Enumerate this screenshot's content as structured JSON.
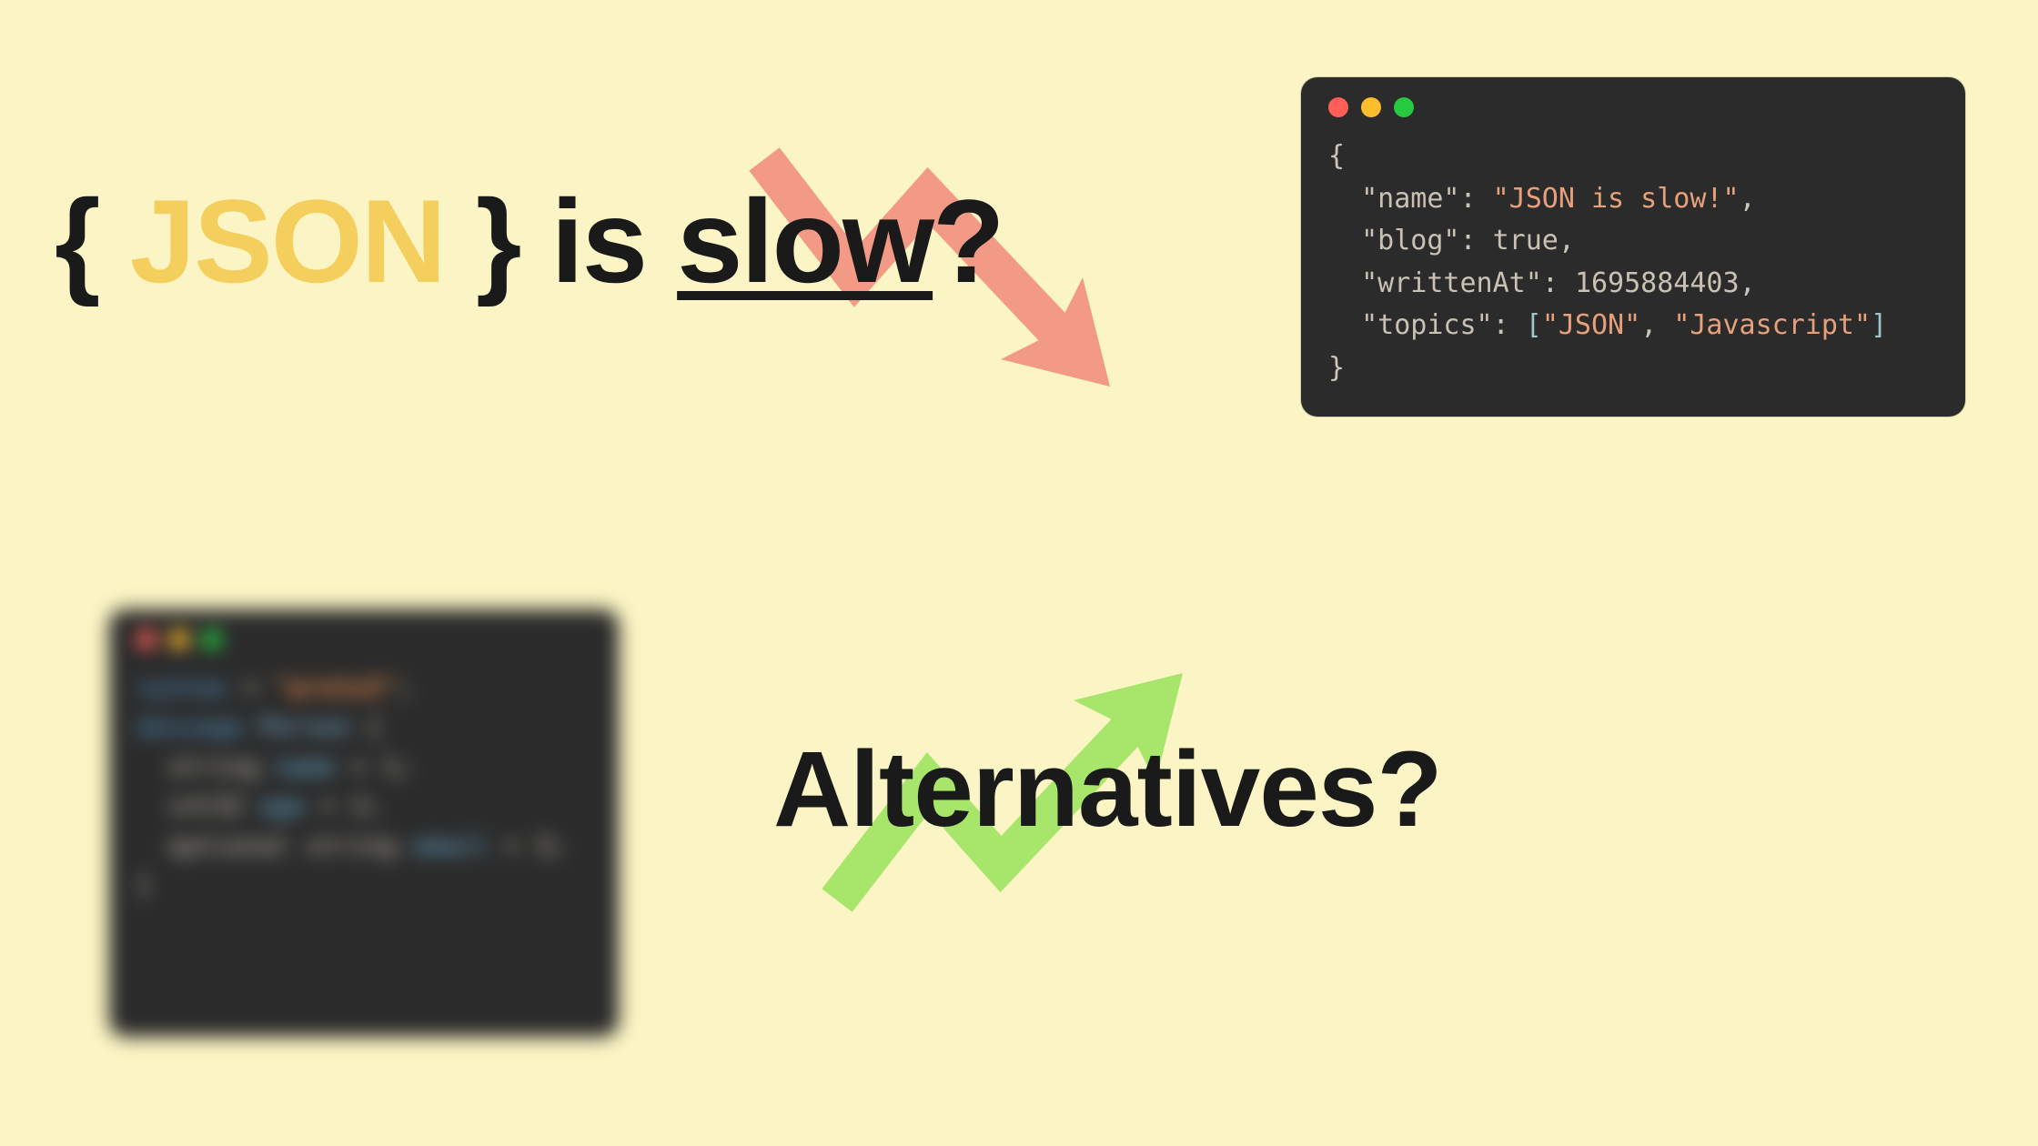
{
  "headline": {
    "brace_open": "{",
    "json": "JSON",
    "brace_close": "}",
    "is": "is",
    "slow": "slow",
    "q": "?"
  },
  "alternatives_label": "Alternatives?",
  "json_snippet": {
    "lines": {
      "open": "{",
      "name_key": "\"name\"",
      "name_val": "\"JSON is slow!\"",
      "blog_key": "\"blog\"",
      "blog_val": "true",
      "written_key": "\"writtenAt\"",
      "written_val": "1695884403",
      "topics_key": "\"topics\"",
      "topics_open": "[",
      "topics_v1": "\"JSON\"",
      "topics_v2": "\"Javascript\"",
      "topics_close": "]",
      "close": "}"
    }
  },
  "proto_snippet": {
    "l1_kw": "syntax",
    "l1_eq": " = ",
    "l1_val": "\"proto3\"",
    "l1_end": ";",
    "l2_kw": "message",
    "l2_name": " Person ",
    "l2_open": "{",
    "l3": "  string ",
    "l3_field": "name",
    "l3_rest": " = 1;",
    "l4": "  int32 ",
    "l4_field": "age",
    "l4_rest": " = 2;",
    "l5": "  optional string ",
    "l5_field": "email",
    "l5_rest": " = 3;",
    "l6": "}"
  },
  "colors": {
    "bg": "#fbf4c4",
    "accent_yellow": "#f4cf5d",
    "arrow_down": "#f29a85",
    "arrow_up": "#a7e66b",
    "window_bg": "#2b2b2b"
  }
}
